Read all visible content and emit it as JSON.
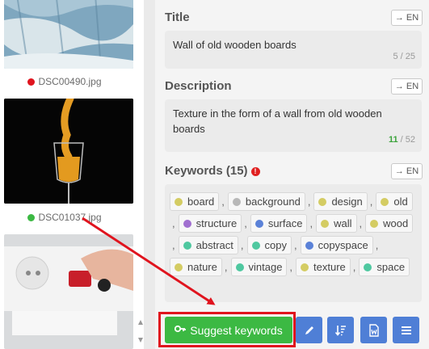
{
  "thumbnails": [
    {
      "filename": "DSC00490.jpg",
      "status_color": "#e0141e"
    },
    {
      "filename": "DSC01037.jpg",
      "status_color": "#3cb943"
    },
    {
      "filename": "",
      "status_color": ""
    }
  ],
  "title_section": {
    "label": "Title",
    "translate_label": "→ EN",
    "value": "Wall of old wooden boards",
    "counter": "5 / 25"
  },
  "description_section": {
    "label": "Description",
    "translate_label": "→ EN",
    "value": "Texture in the form of a wall from old wooden boards",
    "counter_current": "11",
    "counter_sep": " / ",
    "counter_max": "52"
  },
  "keywords_section": {
    "label": "Keywords (15)",
    "warning_glyph": "!",
    "translate_label": "→ EN",
    "keywords": [
      {
        "text": "board",
        "color": "#d4cc63"
      },
      {
        "text": "background",
        "color": "#b8b8b8"
      },
      {
        "text": "design",
        "color": "#d4cc63"
      },
      {
        "text": "old",
        "color": "#d4cc63"
      },
      {
        "text": "structure",
        "color": "#a06fd0"
      },
      {
        "text": "surface",
        "color": "#5b82d8"
      },
      {
        "text": "wall",
        "color": "#d4cc63"
      },
      {
        "text": "wood",
        "color": "#d4cc63"
      },
      {
        "text": "abstract",
        "color": "#4fc8a0"
      },
      {
        "text": "copy",
        "color": "#4fc8a0"
      },
      {
        "text": "copyspace",
        "color": "#5b82d8"
      },
      {
        "text": "nature",
        "color": "#d4cc63"
      },
      {
        "text": "vintage",
        "color": "#4fc8a0"
      },
      {
        "text": "texture",
        "color": "#d4cc63"
      },
      {
        "text": "space",
        "color": "#4fc8a0"
      }
    ]
  },
  "toolbar": {
    "suggest_label": "Suggest keywords",
    "accent": "#3cb943",
    "icon_buttons": [
      "pencil-icon",
      "sort-icon",
      "word-doc-icon",
      "menu-icon"
    ]
  },
  "annotation": {
    "color": "#e0141e"
  }
}
